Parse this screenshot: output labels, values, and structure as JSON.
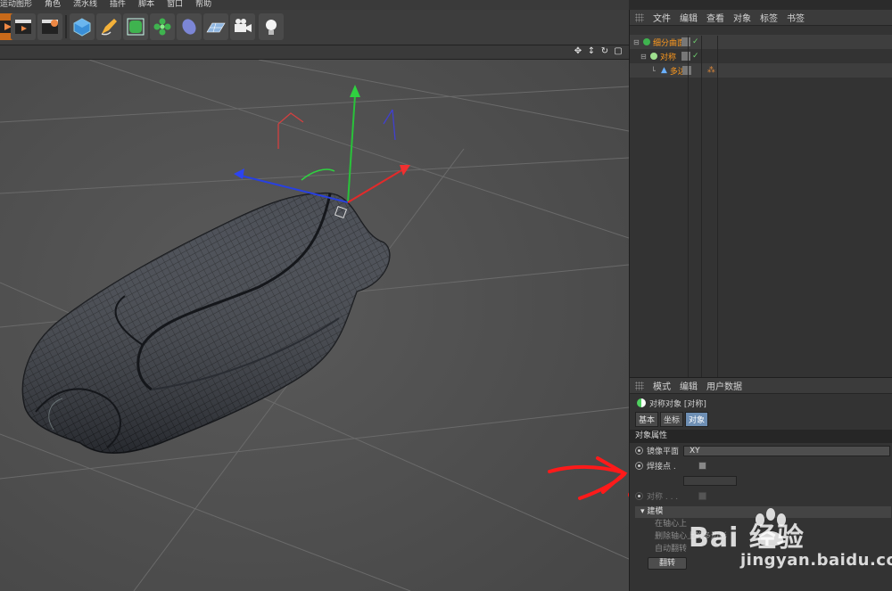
{
  "menu": {
    "items": [
      "运动图形",
      "角色",
      "流水线",
      "插件",
      "脚本",
      "窗口",
      "帮助"
    ]
  },
  "object_manager": {
    "menu": [
      "文件",
      "编辑",
      "查看",
      "对象",
      "标签",
      "书签"
    ],
    "objects": [
      {
        "name": "细分曲面",
        "color": "#ff9a1e"
      },
      {
        "name": "对称",
        "color": "#ff9a1e"
      },
      {
        "name": "多边",
        "color": "#ff9a1e"
      }
    ]
  },
  "attribute_manager": {
    "menu": [
      "模式",
      "编辑",
      "用户数据"
    ],
    "title": "对称对象 [对称]",
    "tabs": [
      "基本",
      "坐标",
      "对象"
    ],
    "active_tab": "对象",
    "section": "对象属性",
    "props": {
      "mirror_plane_label": "镜像平面",
      "mirror_plane_value": "XY",
      "weld_label": "焊接点 .",
      "symmetry_label": "对称 . . ."
    },
    "subsection": "建模",
    "dim_lines": [
      "在轴心上",
      "删除轴心上的多边形",
      "自动翻转"
    ],
    "button": "翻转"
  },
  "watermark": {
    "brand": "Bai 经验",
    "url": "jingyan.baidu.com"
  }
}
